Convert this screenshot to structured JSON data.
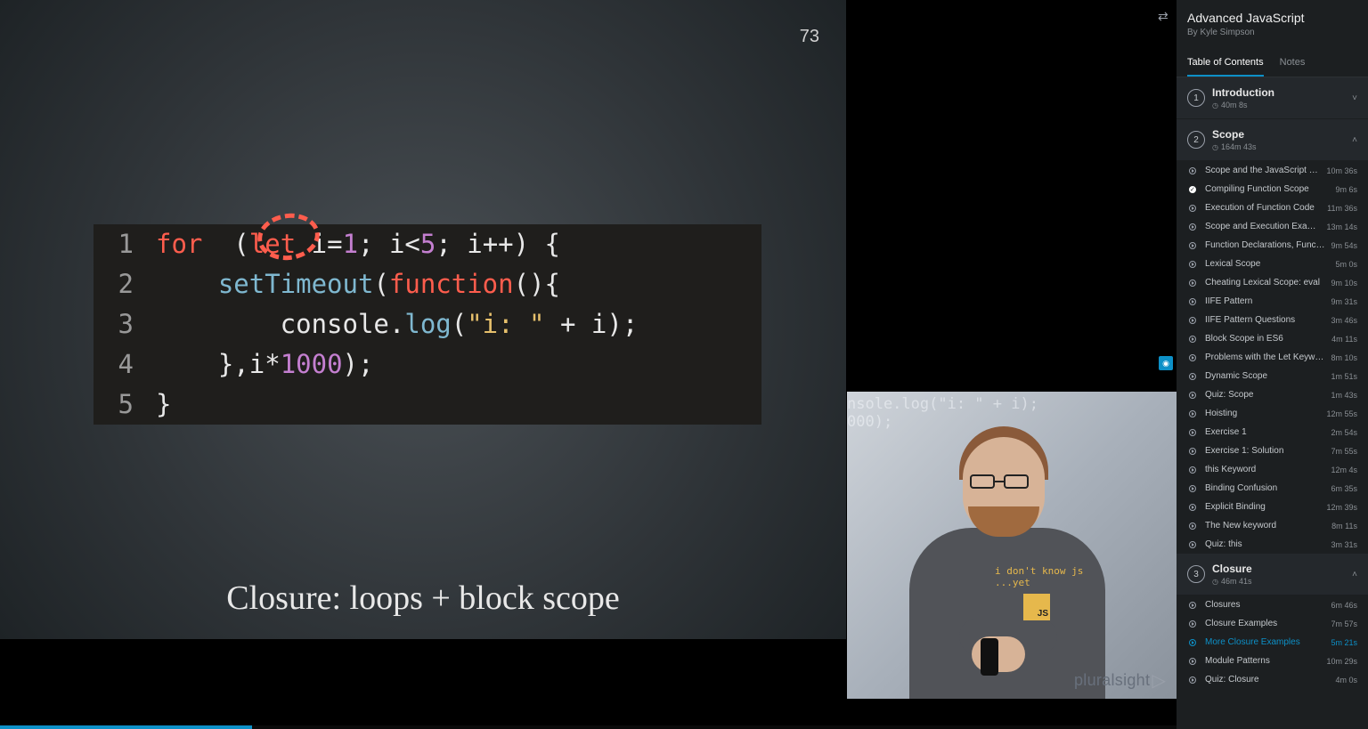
{
  "course": {
    "title": "Advanced JavaScript",
    "author": "By Kyle Simpson"
  },
  "tabs": [
    {
      "label": "Table of Contents",
      "active": true
    },
    {
      "label": "Notes",
      "active": false
    }
  ],
  "slide": {
    "number": "73",
    "title": "Closure: loops + block scope",
    "code": [
      {
        "n": "1",
        "tokens": [
          [
            "kw",
            "for"
          ],
          [
            "",
            "  ("
          ],
          [
            "kw",
            "let"
          ],
          [
            "",
            " i="
          ],
          [
            "num",
            "1"
          ],
          [
            "",
            "; i<"
          ],
          [
            "num",
            "5"
          ],
          [
            "",
            "; i++) {"
          ]
        ]
      },
      {
        "n": "2",
        "tokens": [
          [
            "",
            "    "
          ],
          [
            "fn",
            "setTimeout"
          ],
          [
            "",
            "("
          ],
          [
            "kw",
            "function"
          ],
          [
            "",
            "(){"
          ]
        ]
      },
      {
        "n": "3",
        "tokens": [
          [
            "",
            "        console."
          ],
          [
            "fn",
            "log"
          ],
          [
            "",
            "("
          ],
          [
            "str",
            "\"i: \""
          ],
          [
            "",
            " + i);"
          ]
        ]
      },
      {
        "n": "4",
        "tokens": [
          [
            "",
            "    },i*"
          ],
          [
            "num",
            "1000"
          ],
          [
            "",
            ");"
          ]
        ]
      },
      {
        "n": "5",
        "tokens": [
          [
            "",
            "}"
          ]
        ]
      }
    ]
  },
  "pip": {
    "bg_line1": "nsole.log(\"i: \" + i);",
    "bg_line2": "000);",
    "tshirt_line1": "i don't know js",
    "tshirt_line2": "...yet",
    "tshirt_badge": "JS"
  },
  "watermark": "pluralsight",
  "sections": [
    {
      "num": "1",
      "title": "Introduction",
      "duration": "40m 8s",
      "expanded": false,
      "clips": []
    },
    {
      "num": "2",
      "title": "Scope",
      "duration": "164m 43s",
      "expanded": true,
      "clips": [
        {
          "title": "Scope and the JavaScript Com...",
          "duration": "10m 36s",
          "state": "play"
        },
        {
          "title": "Compiling Function Scope",
          "duration": "9m 6s",
          "state": "done"
        },
        {
          "title": "Execution of Function Code",
          "duration": "11m 36s",
          "state": "play"
        },
        {
          "title": "Scope and Execution Example",
          "duration": "13m 14s",
          "state": "play"
        },
        {
          "title": "Function Declarations, Functio...",
          "duration": "9m 54s",
          "state": "play"
        },
        {
          "title": "Lexical Scope",
          "duration": "5m 0s",
          "state": "play"
        },
        {
          "title": "Cheating Lexical Scope: eval",
          "duration": "9m 10s",
          "state": "play"
        },
        {
          "title": "IIFE Pattern",
          "duration": "9m 31s",
          "state": "play"
        },
        {
          "title": "IIFE Pattern Questions",
          "duration": "3m 46s",
          "state": "play"
        },
        {
          "title": "Block Scope in ES6",
          "duration": "4m 11s",
          "state": "play"
        },
        {
          "title": "Problems with the Let Keyword",
          "duration": "8m 10s",
          "state": "play"
        },
        {
          "title": "Dynamic Scope",
          "duration": "1m 51s",
          "state": "play"
        },
        {
          "title": "Quiz: Scope",
          "duration": "1m 43s",
          "state": "play"
        },
        {
          "title": "Hoisting",
          "duration": "12m 55s",
          "state": "play"
        },
        {
          "title": "Exercise 1",
          "duration": "2m 54s",
          "state": "play"
        },
        {
          "title": "Exercise 1: Solution",
          "duration": "7m 55s",
          "state": "play"
        },
        {
          "title": "this Keyword",
          "duration": "12m 4s",
          "state": "play"
        },
        {
          "title": "Binding Confusion",
          "duration": "6m 35s",
          "state": "play"
        },
        {
          "title": "Explicit Binding",
          "duration": "12m 39s",
          "state": "play"
        },
        {
          "title": "The New keyword",
          "duration": "8m 11s",
          "state": "play"
        },
        {
          "title": "Quiz: this",
          "duration": "3m 31s",
          "state": "play"
        }
      ]
    },
    {
      "num": "3",
      "title": "Closure",
      "duration": "46m 41s",
      "expanded": true,
      "clips": [
        {
          "title": "Closures",
          "duration": "6m 46s",
          "state": "play"
        },
        {
          "title": "Closure Examples",
          "duration": "7m 57s",
          "state": "play"
        },
        {
          "title": "More Closure Examples",
          "duration": "5m 21s",
          "state": "active"
        },
        {
          "title": "Module Patterns",
          "duration": "10m 29s",
          "state": "play"
        },
        {
          "title": "Quiz: Closure",
          "duration": "4m 0s",
          "state": "play"
        }
      ]
    }
  ]
}
